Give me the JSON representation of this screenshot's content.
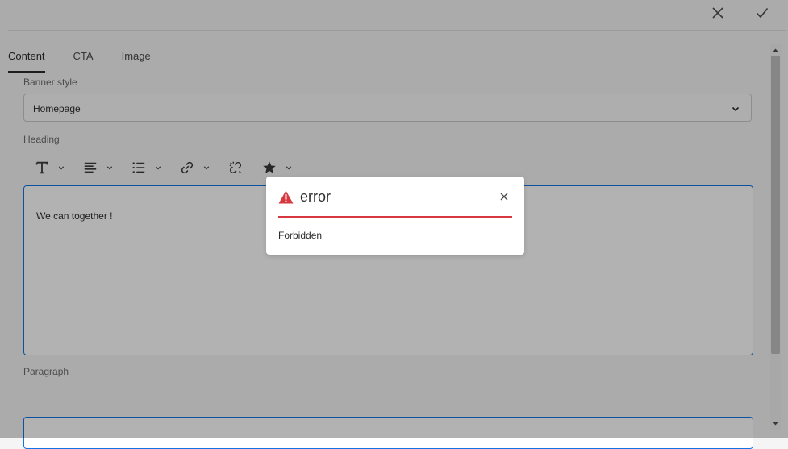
{
  "topbar": {
    "cancel_icon": "close-icon",
    "done_icon": "checkmark-icon"
  },
  "tabs": [
    {
      "label": "Content",
      "active": true
    },
    {
      "label": "CTA",
      "active": false
    },
    {
      "label": "Image",
      "active": false
    }
  ],
  "form": {
    "banner_style": {
      "label": "Banner style",
      "value": "Homepage"
    },
    "heading": {
      "label": "Heading",
      "content": "We can together !"
    },
    "paragraph": {
      "label": "Paragraph"
    }
  },
  "toolbar": {
    "icons": [
      "text-format-icon",
      "align-icon",
      "list-icon",
      "link-icon",
      "unlink-icon",
      "star-icon"
    ]
  },
  "dialog": {
    "title": "error",
    "message": "Forbidden",
    "accent_color": "#d7373f",
    "icon": "alert-icon"
  },
  "colors": {
    "focus_border": "#1473e6",
    "error": "#d7373f"
  }
}
